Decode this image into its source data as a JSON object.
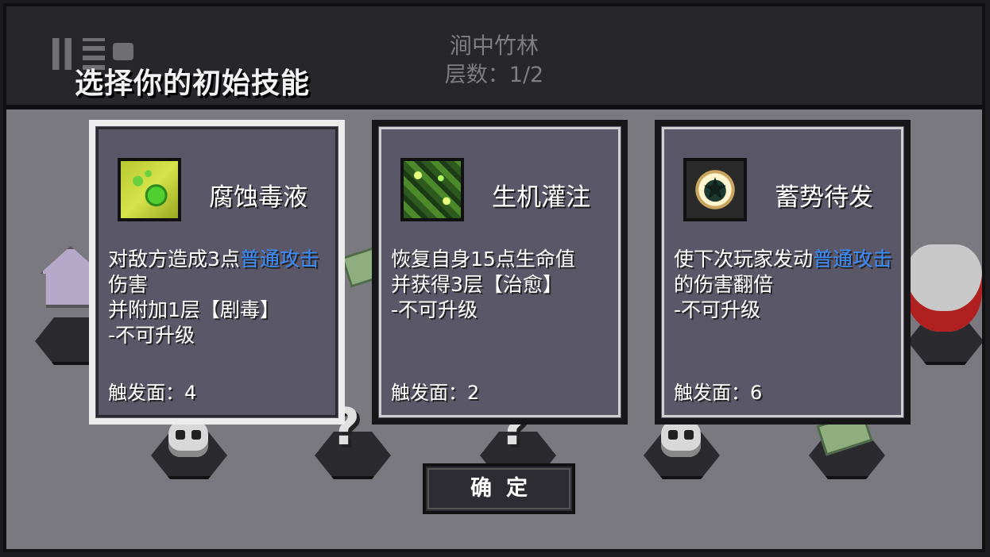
{
  "header": {
    "page_title": "选择你的初始技能",
    "level_name": "涧中竹林",
    "floor_label": "层数：1/2"
  },
  "top_icons": [
    "pause-icon",
    "menu-icon",
    "bag-icon"
  ],
  "cards": [
    {
      "name": "腐蚀毒液",
      "icon": "poison-skill-icon",
      "desc_before": "对敌方造成3点",
      "desc_highlight": "普通攻击",
      "desc_after": "伤害\n并附加1层【剧毒】\n-不可升级",
      "trigger": "触发面：4",
      "selected": true
    },
    {
      "name": "生机灌注",
      "icon": "vitality-skill-icon",
      "desc_before": "恢复自身15点生命值\n并获得3层【治愈】\n-不可升级",
      "desc_highlight": "",
      "desc_after": "",
      "trigger": "触发面：2",
      "selected": false
    },
    {
      "name": "蓄势待发",
      "icon": "charge-skill-icon",
      "desc_before": "使下次玩家发动",
      "desc_highlight": "普通攻击",
      "desc_after": "的伤害翻倍\n-不可升级",
      "trigger": "触发面：6",
      "selected": false
    }
  ],
  "confirm_label": "确定",
  "colors": {
    "highlight": "#3a8cff",
    "card_bg": "#5a5868",
    "board_bg": "#7a7980",
    "topbar_bg": "#26262b"
  }
}
